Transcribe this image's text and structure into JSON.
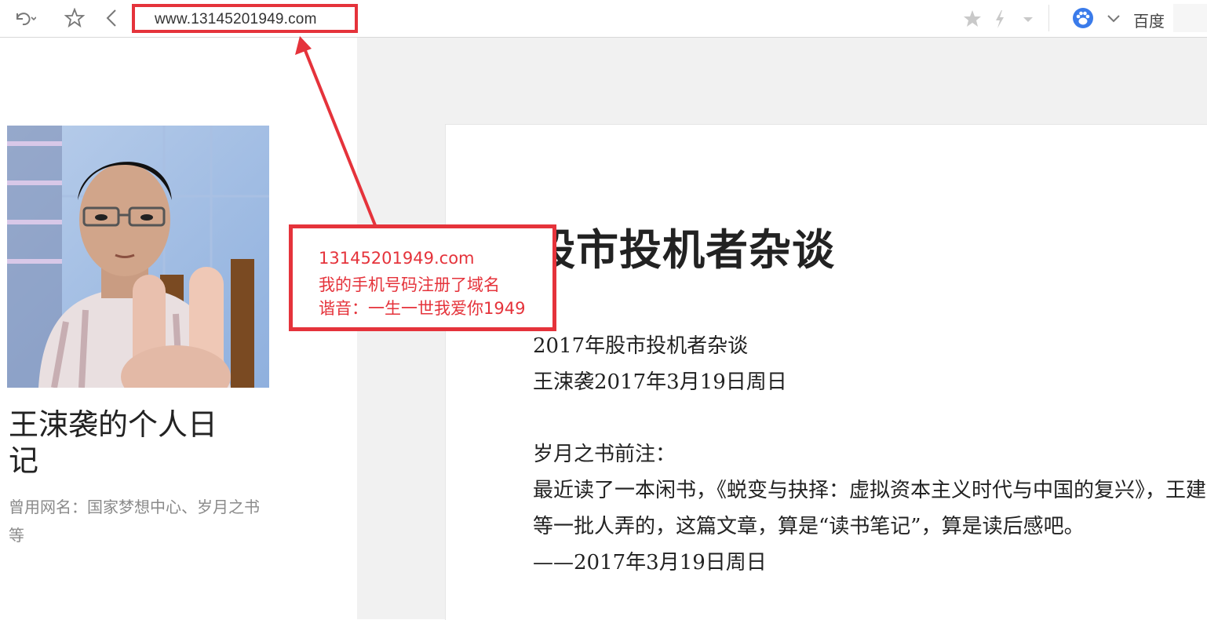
{
  "toolbar": {
    "address": "www.13145201949.com",
    "search_engine": "百度"
  },
  "sidebar": {
    "blog_title": "王涑袭的个人日记",
    "blog_subtitle": "曾用网名：国家梦想中心、岁月之书等"
  },
  "article": {
    "title": "股市投机者杂谈",
    "lines": [
      "2017年股市投机者杂谈",
      "王涑袭2017年3月19日周日",
      "",
      "岁月之书前注：",
      "最近读了一本闲书，《蜕变与抉择：虚拟资本主义时代与中国的复兴》，王建等一批人弄的，这篇文章，算是“读书笔记”，算是读后感吧。",
      "——2017年3月19日周日"
    ]
  },
  "annotation": {
    "line1": "13145201949.com",
    "line2": "我的手机号码注册了域名",
    "line3": "谐音：一生一世我爱你1949",
    "color": "#e5333b"
  },
  "colors": {
    "annotation_red": "#e5333b",
    "page_bg": "#f1f1f1"
  }
}
